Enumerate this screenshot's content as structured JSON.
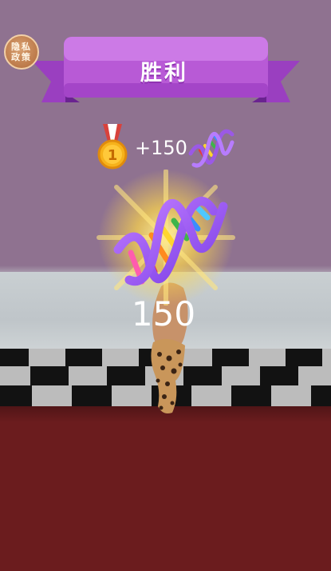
{
  "privacy_button": {
    "label": "隐私政策"
  },
  "banner": {
    "title": "胜利"
  },
  "reward": {
    "text": "+150",
    "medal_number": "1"
  },
  "dna_amount": "150",
  "icons": {
    "medal": "gold-medal-icon",
    "dna_small": "dna-icon",
    "dna_large": "dna-glow-icon"
  },
  "colors": {
    "banner_purple": "#b85ad6",
    "sky": "#8f7290",
    "floor": "#6b1c1e",
    "glow": "#ffd84a"
  }
}
